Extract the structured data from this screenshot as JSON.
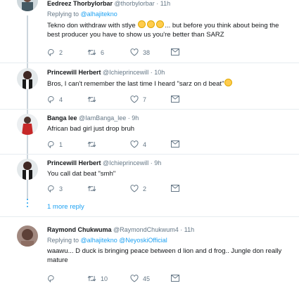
{
  "tweets": [
    {
      "name": "Eedreez Thorbylorbar",
      "handle": "@thorbylorbar",
      "time": "11h",
      "replying_prefix": "Replying to",
      "replying_to": "@alhajitekno",
      "text_before_emoji": "Tekno don withdraw with stlye",
      "text_after_emoji": "... but before you think about being the",
      "text_line2": "best producer you have to show us you're better than SARZ",
      "replies": "2",
      "retweets": "6",
      "likes": "38"
    },
    {
      "name": "Princewill Herbert",
      "handle": "@Ichieprincewill",
      "time": "10h",
      "text": "Bros, I can't remember the last time I heard \"sarz on d beat\"",
      "replies": "4",
      "retweets": "",
      "likes": "7"
    },
    {
      "name": "Banga lee",
      "handle": "@IamBanga_lee",
      "time": "9h",
      "text": "African bad girl just drop bruh",
      "replies": "1",
      "retweets": "",
      "likes": "4"
    },
    {
      "name": "Princewill Herbert",
      "handle": "@Ichieprincewill",
      "time": "9h",
      "text": "You call dat beat \"smh\"",
      "replies": "3",
      "retweets": "",
      "likes": "2"
    },
    {
      "name": "Raymond Chukwuma",
      "handle": "@RaymondChukwum4",
      "time": "11h",
      "replying_prefix": "Replying to",
      "replying_to": "@alhajitekno @NeyoskiOfficial",
      "text_line1": "waawu... D duck is bringing peace between d lion and d frog.. Jungle don really",
      "text_line2": "mature",
      "replies": "",
      "retweets": "10",
      "likes": "45"
    }
  ],
  "more_replies": "1 more reply",
  "colors": {
    "link": "#1da1f2",
    "muted": "#657786",
    "thread_line": "#ccd6dd",
    "emoji": "#ffcc4d"
  },
  "icons": [
    "reply-icon",
    "retweet-icon",
    "like-icon",
    "message-icon",
    "emoji-icon"
  ]
}
